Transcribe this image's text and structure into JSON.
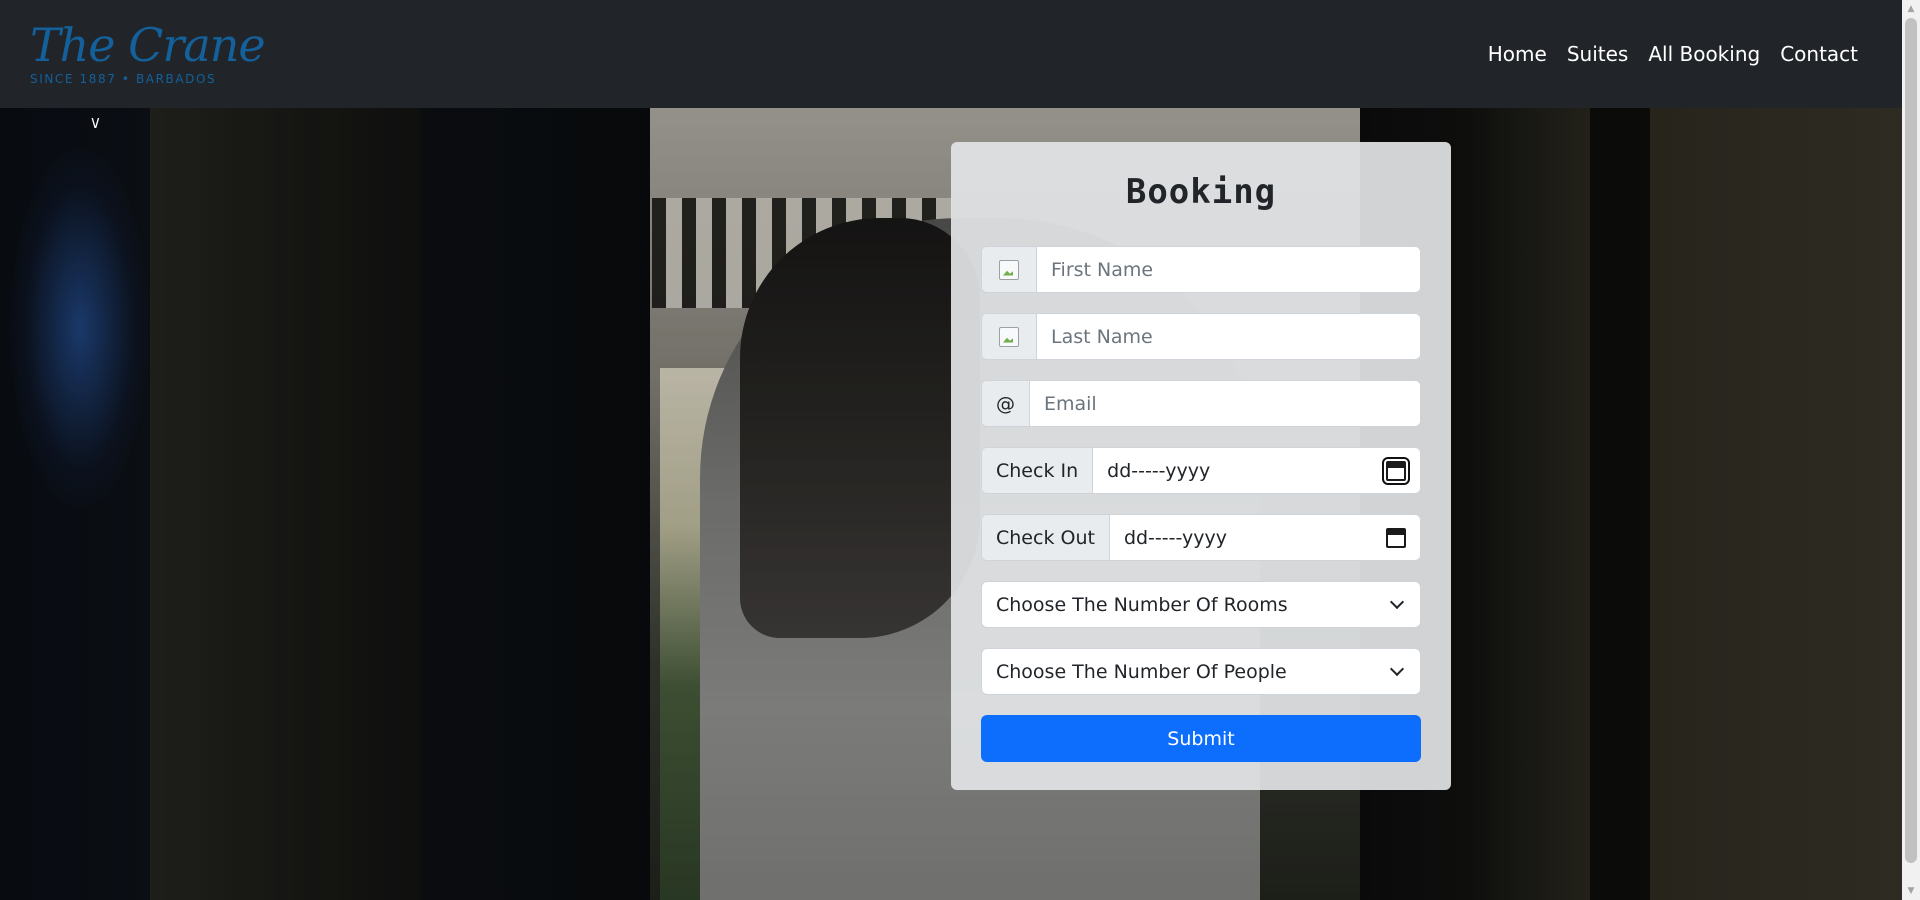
{
  "brand": {
    "name": "The Crane",
    "tagline": "SINCE 1887 • BARBADOS"
  },
  "nav": {
    "links": [
      "Home",
      "Suites",
      "All Booking",
      "Contact"
    ]
  },
  "scene": {
    "mark": "v"
  },
  "form": {
    "title": "Booking",
    "first_name_placeholder": "First Name",
    "last_name_placeholder": "Last Name",
    "email_addon": "@",
    "email_placeholder": "Email",
    "check_in_label": "Check In",
    "check_in_value": "dd-----yyyy",
    "check_out_label": "Check Out",
    "check_out_value": "dd-----yyyy",
    "rooms_select": "Choose The Number Of Rooms",
    "people_select": "Choose The Number Of People",
    "submit_label": "Submit"
  },
  "colors": {
    "navbar": "#212529",
    "brand": "#13609a",
    "primary": "#0d6efd"
  }
}
